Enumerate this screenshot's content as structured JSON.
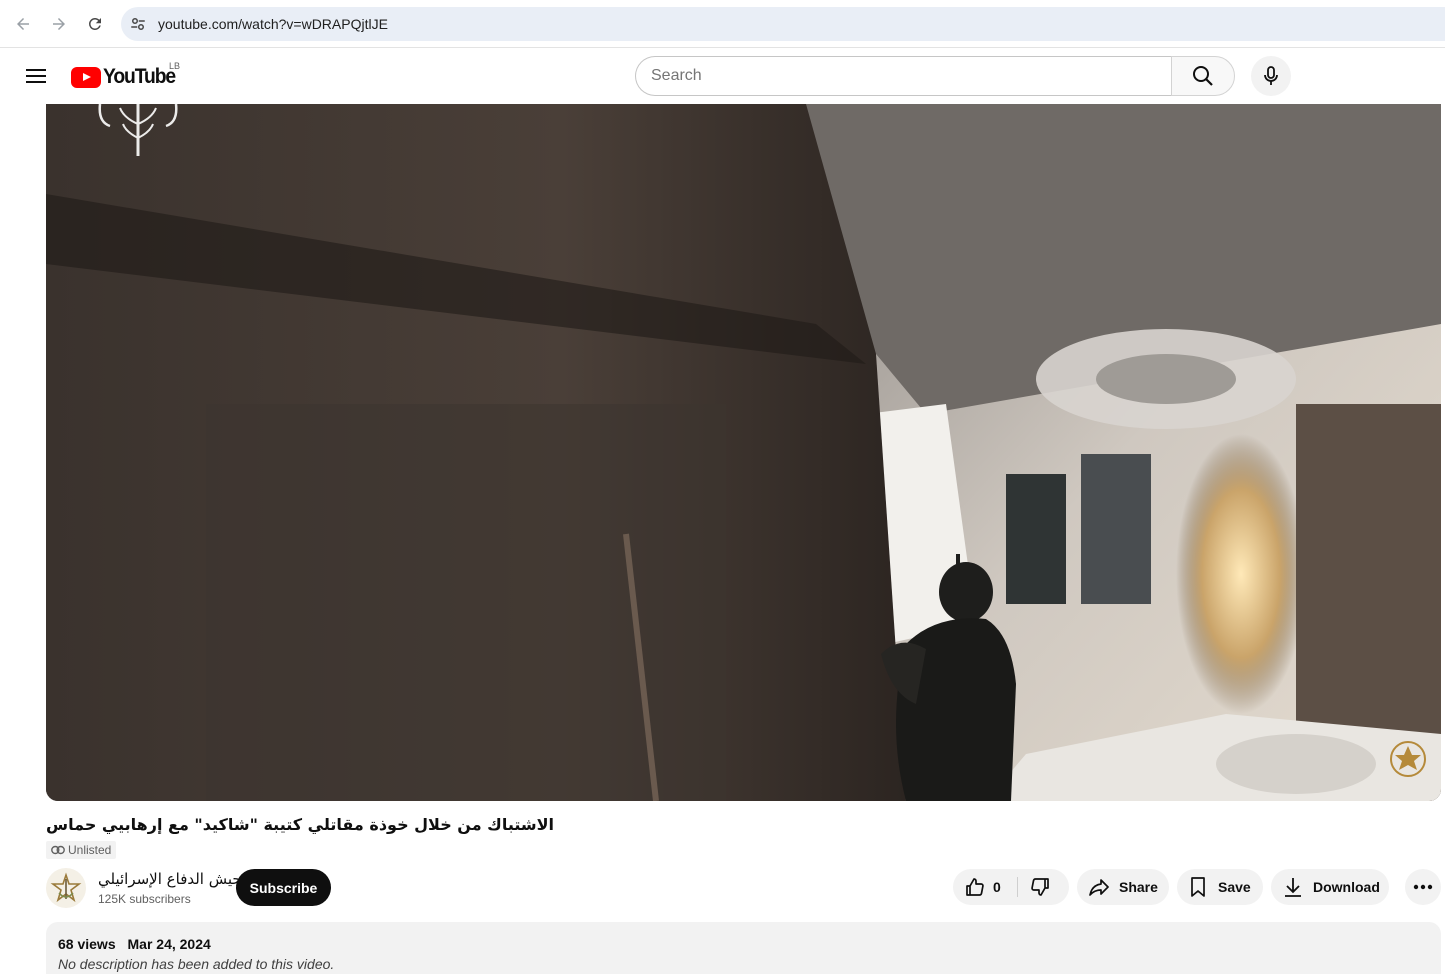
{
  "browser": {
    "url": "youtube.com/watch?v=wDRAPQjtlJE"
  },
  "masthead": {
    "logo_text": "YouTube",
    "country_code": "LB",
    "search_placeholder": "Search"
  },
  "video": {
    "title": "الاشتباك من خلال خوذة مقاتلي كتيبة \"شاكيد\" مع إرهابيي حماس",
    "visibility": "Unlisted"
  },
  "channel": {
    "name": "جيش الدفاع الإسرائيلي",
    "subscribers": "125K subscribers",
    "subscribe_label": "Subscribe"
  },
  "actions": {
    "like_count": "0",
    "share_label": "Share",
    "save_label": "Save",
    "download_label": "Download"
  },
  "description": {
    "views": "68 views",
    "date": "Mar 24, 2024",
    "text": "No description has been added to this video."
  },
  "colors": {
    "youtube_red": "#ff0000",
    "subscribe_bg": "#0f0f0f",
    "pill_bg": "#f2f2f2",
    "url_bar_bg": "#e9eef6"
  }
}
